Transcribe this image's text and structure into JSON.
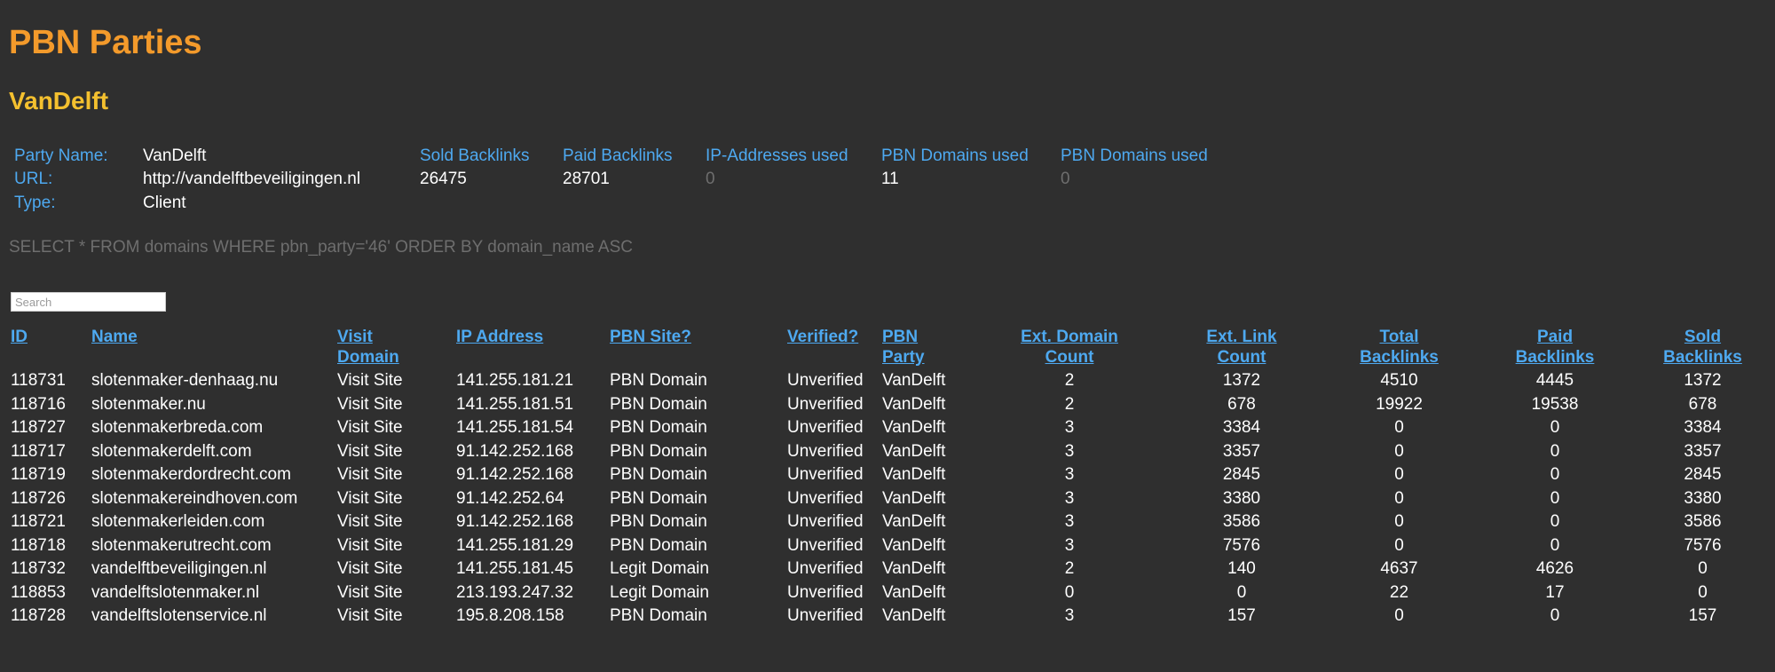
{
  "title": "PBN Parties",
  "party_heading": "VanDelft",
  "info": {
    "labels": {
      "party_name": "Party Name:",
      "url": "URL:",
      "type": "Type:"
    },
    "party_name": "VanDelft",
    "url": "http://vandelftbeveiligingen.nl",
    "type": "Client",
    "stats": [
      {
        "label": "Sold Backlinks",
        "value": "26475"
      },
      {
        "label": "Paid Backlinks",
        "value": "28701"
      },
      {
        "label": "IP-Addresses used",
        "value": "0"
      },
      {
        "label": "PBN Domains used",
        "value": "11"
      },
      {
        "label": "PBN Domains used",
        "value": "0"
      }
    ]
  },
  "query": "SELECT * FROM domains WHERE pbn_party='46' ORDER BY domain_name ASC",
  "search": {
    "placeholder": "Search",
    "value": ""
  },
  "columns": [
    {
      "key": "id",
      "lines": [
        "ID"
      ]
    },
    {
      "key": "name",
      "lines": [
        "Name"
      ]
    },
    {
      "key": "visit",
      "lines": [
        "Visit",
        "Domain"
      ]
    },
    {
      "key": "ip",
      "lines": [
        "IP Address"
      ]
    },
    {
      "key": "pbn_site",
      "lines": [
        "PBN Site?"
      ]
    },
    {
      "key": "verified",
      "lines": [
        "Verified?"
      ]
    },
    {
      "key": "party",
      "lines": [
        "PBN",
        "Party"
      ]
    },
    {
      "key": "ext_domain",
      "lines": [
        "Ext. Domain",
        "Count"
      ]
    },
    {
      "key": "ext_link",
      "lines": [
        "Ext. Link",
        "Count"
      ]
    },
    {
      "key": "total",
      "lines": [
        "Total",
        "Backlinks"
      ]
    },
    {
      "key": "paid",
      "lines": [
        "Paid",
        "Backlinks"
      ]
    },
    {
      "key": "sold",
      "lines": [
        "Sold",
        "Backlinks"
      ]
    }
  ],
  "rows": [
    {
      "id": "118731",
      "name": "slotenmaker-denhaag.nu",
      "visit": "Visit Site",
      "ip": "141.255.181.21",
      "pbn_site": "PBN Domain",
      "verified": "Unverified",
      "party": "VanDelft",
      "ext_domain": "2",
      "ext_link": "1372",
      "total": "4510",
      "paid": "4445",
      "sold": "1372"
    },
    {
      "id": "118716",
      "name": "slotenmaker.nu",
      "visit": "Visit Site",
      "ip": "141.255.181.51",
      "pbn_site": "PBN Domain",
      "verified": "Unverified",
      "party": "VanDelft",
      "ext_domain": "2",
      "ext_link": "678",
      "total": "19922",
      "paid": "19538",
      "sold": "678"
    },
    {
      "id": "118727",
      "name": "slotenmakerbreda.com",
      "visit": "Visit Site",
      "ip": "141.255.181.54",
      "pbn_site": "PBN Domain",
      "verified": "Unverified",
      "party": "VanDelft",
      "ext_domain": "3",
      "ext_link": "3384",
      "total": "0",
      "paid": "0",
      "sold": "3384"
    },
    {
      "id": "118717",
      "name": "slotenmakerdelft.com",
      "visit": "Visit Site",
      "ip": "91.142.252.168",
      "pbn_site": "PBN Domain",
      "verified": "Unverified",
      "party": "VanDelft",
      "ext_domain": "3",
      "ext_link": "3357",
      "total": "0",
      "paid": "0",
      "sold": "3357"
    },
    {
      "id": "118719",
      "name": "slotenmakerdordrecht.com",
      "visit": "Visit Site",
      "ip": "91.142.252.168",
      "pbn_site": "PBN Domain",
      "verified": "Unverified",
      "party": "VanDelft",
      "ext_domain": "3",
      "ext_link": "2845",
      "total": "0",
      "paid": "0",
      "sold": "2845"
    },
    {
      "id": "118726",
      "name": "slotenmakereindhoven.com",
      "visit": "Visit Site",
      "ip": "91.142.252.64",
      "pbn_site": "PBN Domain",
      "verified": "Unverified",
      "party": "VanDelft",
      "ext_domain": "3",
      "ext_link": "3380",
      "total": "0",
      "paid": "0",
      "sold": "3380"
    },
    {
      "id": "118721",
      "name": "slotenmakerleiden.com",
      "visit": "Visit Site",
      "ip": "91.142.252.168",
      "pbn_site": "PBN Domain",
      "verified": "Unverified",
      "party": "VanDelft",
      "ext_domain": "3",
      "ext_link": "3586",
      "total": "0",
      "paid": "0",
      "sold": "3586"
    },
    {
      "id": "118718",
      "name": "slotenmakerutrecht.com",
      "visit": "Visit Site",
      "ip": "141.255.181.29",
      "pbn_site": "PBN Domain",
      "verified": "Unverified",
      "party": "VanDelft",
      "ext_domain": "3",
      "ext_link": "7576",
      "total": "0",
      "paid": "0",
      "sold": "7576"
    },
    {
      "id": "118732",
      "name": "vandelftbeveiligingen.nl",
      "visit": "Visit Site",
      "ip": "141.255.181.45",
      "pbn_site": "Legit Domain",
      "verified": "Unverified",
      "party": "VanDelft",
      "ext_domain": "2",
      "ext_link": "140",
      "total": "4637",
      "paid": "4626",
      "sold": "0"
    },
    {
      "id": "118853",
      "name": "vandelftslotenmaker.nl",
      "visit": "Visit Site",
      "ip": "213.193.247.32",
      "pbn_site": "Legit Domain",
      "verified": "Unverified",
      "party": "VanDelft",
      "ext_domain": "0",
      "ext_link": "0",
      "total": "22",
      "paid": "17",
      "sold": "0"
    },
    {
      "id": "118728",
      "name": "vandelftslotenservice.nl",
      "visit": "Visit Site",
      "ip": "195.8.208.158",
      "pbn_site": "PBN Domain",
      "verified": "Unverified",
      "party": "VanDelft",
      "ext_domain": "3",
      "ext_link": "157",
      "total": "0",
      "paid": "0",
      "sold": "157"
    }
  ],
  "colors": {
    "background": "#2f2f2f",
    "title": "#f39a2b",
    "heading": "#f4c02f",
    "link": "#4ea9f0",
    "muted": "#6e6e6e",
    "text": "#ffffff"
  }
}
